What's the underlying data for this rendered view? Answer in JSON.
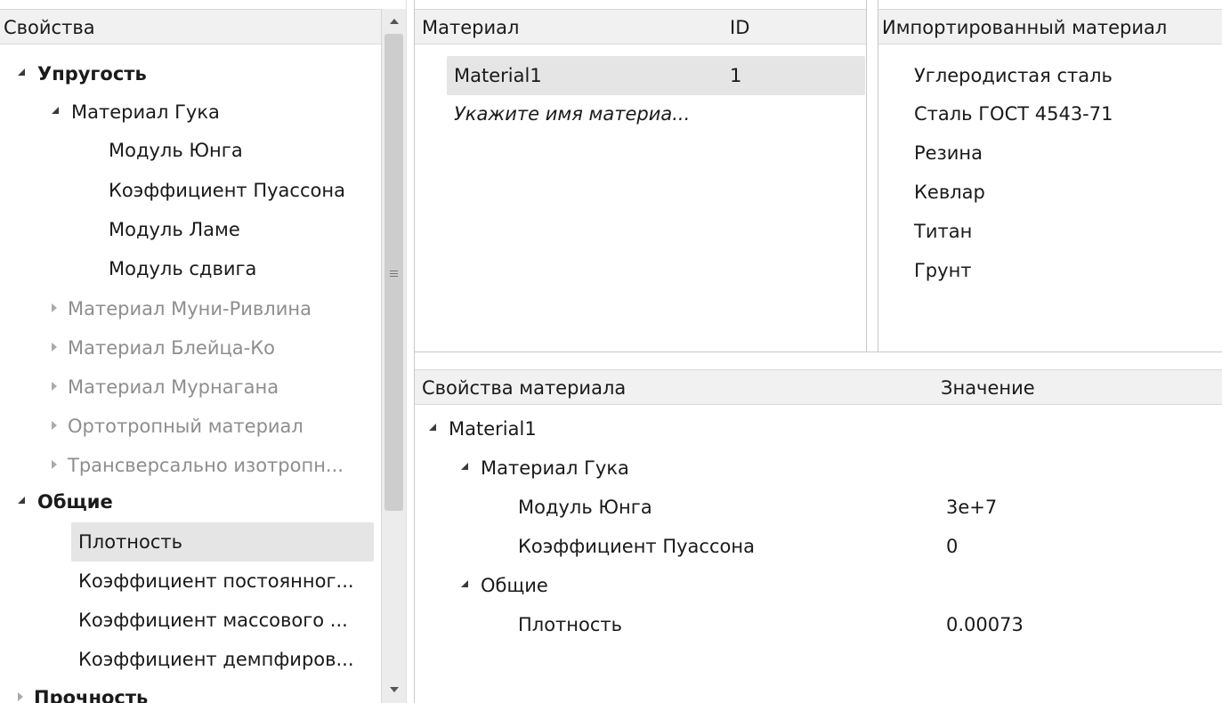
{
  "props_panel": {
    "header": "Свойства",
    "elasticity": {
      "label": "Упругость",
      "hooke": {
        "label": "Материал Гука",
        "items": [
          "Модуль Юнга",
          "Коэффициент Пуассона",
          "Модуль Ламе",
          "Модуль сдвига"
        ]
      },
      "models": [
        "Материал Муни-Ривлина",
        "Материал Блейца-Ко",
        "Материал Мурнагана",
        "Ортотропный материал",
        "Трансверсально изотропн..."
      ]
    },
    "general": {
      "label": "Общие",
      "items": [
        "Плотность",
        "Коэффициент постоянног...",
        "Коэффициент массового ...",
        "Коэффициент демпфиров..."
      ]
    },
    "strength": {
      "label": "Прочность"
    }
  },
  "materials": {
    "col_material": "Материал",
    "col_id": "ID",
    "rows": [
      {
        "name": "Material1",
        "id": "1"
      }
    ],
    "new_placeholder": "Укажите имя материа..."
  },
  "imported": {
    "header": "Импортированный материал",
    "items": [
      "Углеродистая сталь",
      "Сталь ГОСТ 4543-71",
      "Резина",
      "Кевлар",
      "Титан",
      "Грунт"
    ]
  },
  "mat_props": {
    "col_property": "Свойства материала",
    "col_value": "Значение",
    "material": "Material1",
    "hooke": {
      "label": "Материал Гука",
      "young_label": "Модуль Юнга",
      "young_value": "3e+7",
      "poisson_label": "Коэффициент Пуассона",
      "poisson_value": "0"
    },
    "general": {
      "label": "Общие",
      "density_label": "Плотность",
      "density_value": "0.00073"
    }
  }
}
